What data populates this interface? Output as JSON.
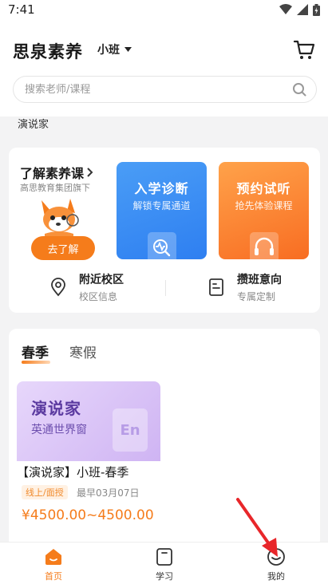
{
  "status_bar": {
    "time": "7:41"
  },
  "header": {
    "brand": "思泉素养",
    "class_selector": "小班",
    "search_placeholder": "搜索老师/课程"
  },
  "peek_label": "演说家",
  "promo": {
    "title": "了解素养课",
    "subtitle": "高思教育集团旗下",
    "button": "去了解"
  },
  "tiles": [
    {
      "title": "入学诊断",
      "subtitle": "解锁专属通道"
    },
    {
      "title": "预约试听",
      "subtitle": "抢先体验课程"
    }
  ],
  "info_links": [
    {
      "title": "附近校区",
      "subtitle": "校区信息"
    },
    {
      "title": "攒班意向",
      "subtitle": "专属定制"
    }
  ],
  "season_tabs": [
    "春季",
    "寒假"
  ],
  "course": {
    "cover_title": "演说家",
    "cover_subtitle": "英通世界窗",
    "cover_logo": "En",
    "name": "【演说家】小班-春季",
    "tag": "线上/面授",
    "date": "最早03月07日",
    "price": "¥4500.00~4500.00"
  },
  "tabbar": [
    {
      "label": "首页",
      "active": true
    },
    {
      "label": "学习",
      "active": false
    },
    {
      "label": "我的",
      "active": false
    }
  ],
  "colors": {
    "accent": "#f57c1b",
    "blue_tile": "#2e7ff1",
    "orange_tile": "#f86d22",
    "arrow": "#e8262a"
  }
}
